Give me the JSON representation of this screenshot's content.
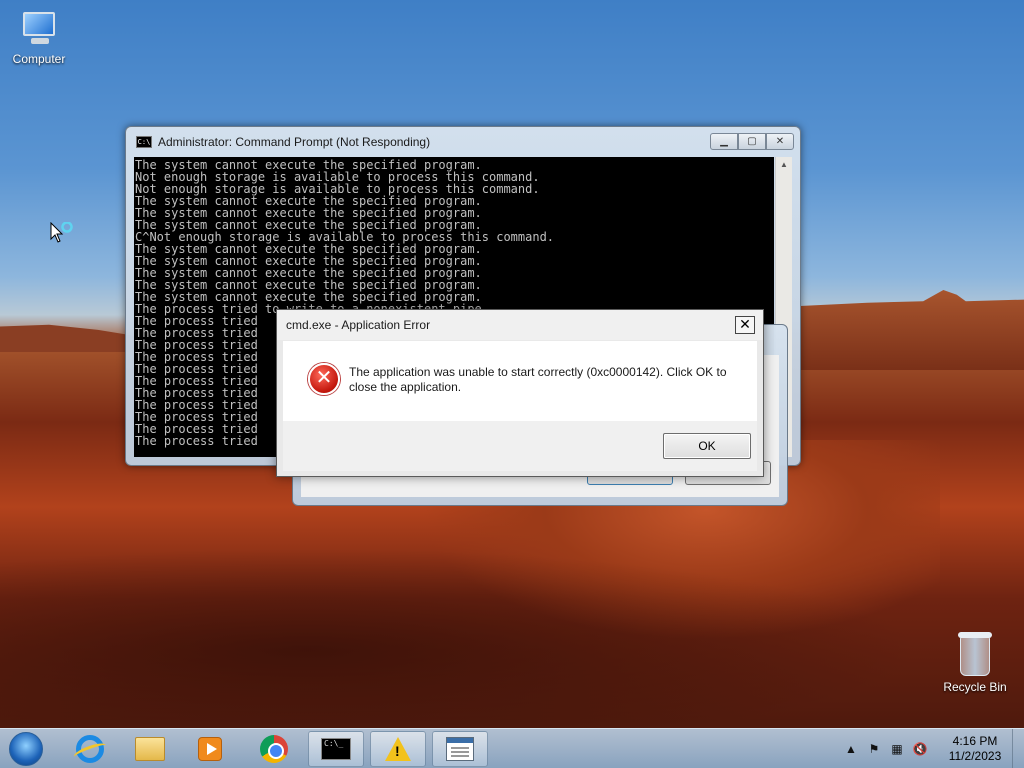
{
  "desktop": {
    "icons": {
      "computer": "Computer",
      "recycle_bin": "Recycle Bin"
    }
  },
  "cmd_window": {
    "title": "Administrator:  Command Prompt (Not Responding)",
    "lines": [
      "The system cannot execute the specified program.",
      "Not enough storage is available to process this command.",
      "Not enough storage is available to process this command.",
      "The system cannot execute the specified program.",
      "The system cannot execute the specified program.",
      "The system cannot execute the specified program.",
      "C^Not enough storage is available to process this command.",
      "The system cannot execute the specified program.",
      "The system cannot execute the specified program.",
      "The system cannot execute the specified program.",
      "The system cannot execute the specified program.",
      "The system cannot execute the specified program.",
      "The process tried to write to a nonexistent pipe.",
      "The process tried",
      "The process tried",
      "The process tried",
      "The process tried",
      "The process tried",
      "The process tried",
      "The process tried",
      "The process tried",
      "The process tried",
      "The process tried",
      "The process tried"
    ]
  },
  "error_dialog": {
    "title": "cmd.exe - Application Error",
    "close_glyph": "✕",
    "message": "The application was unable to start correctly (0xc0000142). Click OK to close the application.",
    "ok_label": "OK"
  },
  "taskbar": {
    "clock_time": "4:16 PM",
    "clock_date": "11/2/2023",
    "icons": [
      "start-orb",
      "internet-explorer-icon",
      "folder-icon",
      "media-player-icon",
      "chrome-icon",
      "cmd-icon",
      "warning-icon",
      "app-window-icon"
    ]
  }
}
